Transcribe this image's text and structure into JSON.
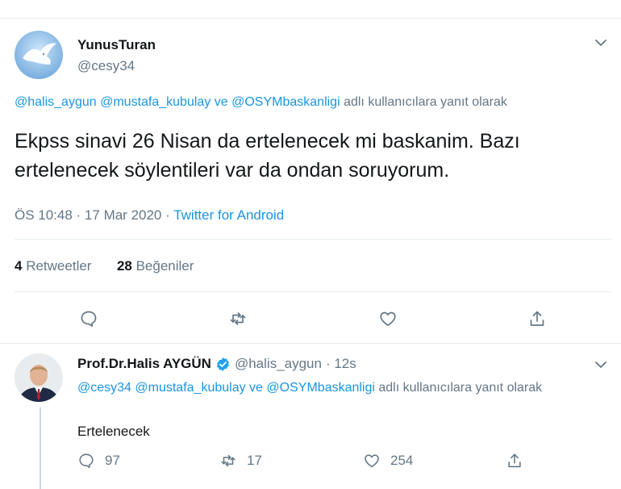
{
  "tweet": {
    "author_name": "YunusTuran",
    "author_handle": "@cesy34",
    "reply_to": {
      "mentions": [
        "@halis_aygun",
        "@mustafa_kubulay",
        "@OSYMbaskanligi"
      ],
      "joiner": "ve",
      "suffix": "adlı kullanıcılara yanıt olarak"
    },
    "text": "Ekpss sinavi 26 Nisan da ertelenecek mi baskanim. Bazı ertelenecek söylentileri var da ondan soruyorum.",
    "time": "ÖS 10:48 · 17 Mar 2020 ·",
    "source": "Twitter for Android",
    "retweet_count": "4",
    "retweet_label": "Retweetler",
    "like_count": "28",
    "like_label": "Beğeniler"
  },
  "reply": {
    "author_name": "Prof.Dr.Halis AYGÜN",
    "author_handle": "@halis_aygun",
    "time": "· 12s",
    "reply_to": {
      "mentions": [
        "@cesy34",
        "@mustafa_kubulay",
        "@OSYMbaskanligi"
      ],
      "joiner": "ve",
      "suffix": "adlı kullanıcılara yanıt olarak"
    },
    "text": "Ertelenecek",
    "reply_count": "97",
    "retweet_count": "17",
    "like_count": "254"
  },
  "colors": {
    "link": "#1b95e0",
    "secondary_text": "#657786",
    "verified": "#1da1f2",
    "divider": "#e6ecf0"
  }
}
